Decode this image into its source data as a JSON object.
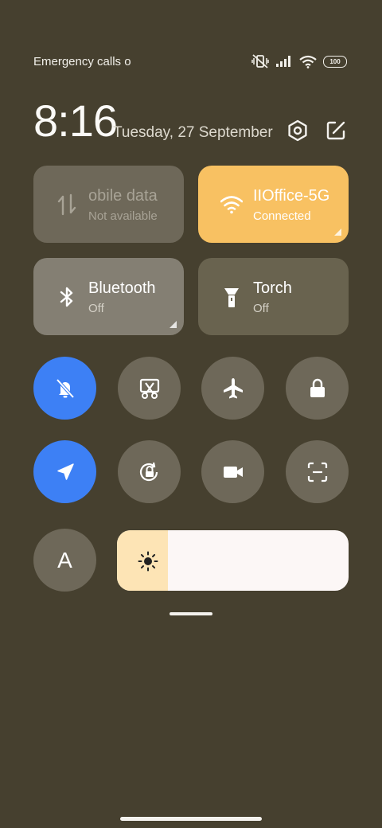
{
  "status": {
    "carrier_text": "Emergency calls o",
    "battery": "100"
  },
  "header": {
    "time": "8:16",
    "date": "Tuesday, 27 September"
  },
  "tiles": {
    "mobile_data": {
      "title": "obile data",
      "subtitle": "Not available"
    },
    "wifi": {
      "title": "IIOffice-5G",
      "subtitle": "Connected"
    },
    "bluetooth": {
      "title": "Bluetooth",
      "subtitle": "Off"
    },
    "torch": {
      "title": "Torch",
      "subtitle": "Off"
    }
  },
  "toggles_row1": [
    {
      "name": "silent-mode-icon",
      "state": "on"
    },
    {
      "name": "screenshot-crop-icon",
      "state": "off"
    },
    {
      "name": "airplane-icon",
      "state": "off"
    },
    {
      "name": "lock-icon",
      "state": "off"
    }
  ],
  "toggles_row2": [
    {
      "name": "location-icon",
      "state": "on"
    },
    {
      "name": "rotation-lock-icon",
      "state": "off"
    },
    {
      "name": "screen-recorder-icon",
      "state": "off"
    },
    {
      "name": "scanner-icon",
      "state": "off"
    }
  ],
  "auto_brightness": {
    "label": "A"
  },
  "brightness": {
    "level": 0.22
  },
  "colors": {
    "background": "#46402f",
    "active_blue": "#3d80f5",
    "wifi_tile": "#f8c162"
  }
}
